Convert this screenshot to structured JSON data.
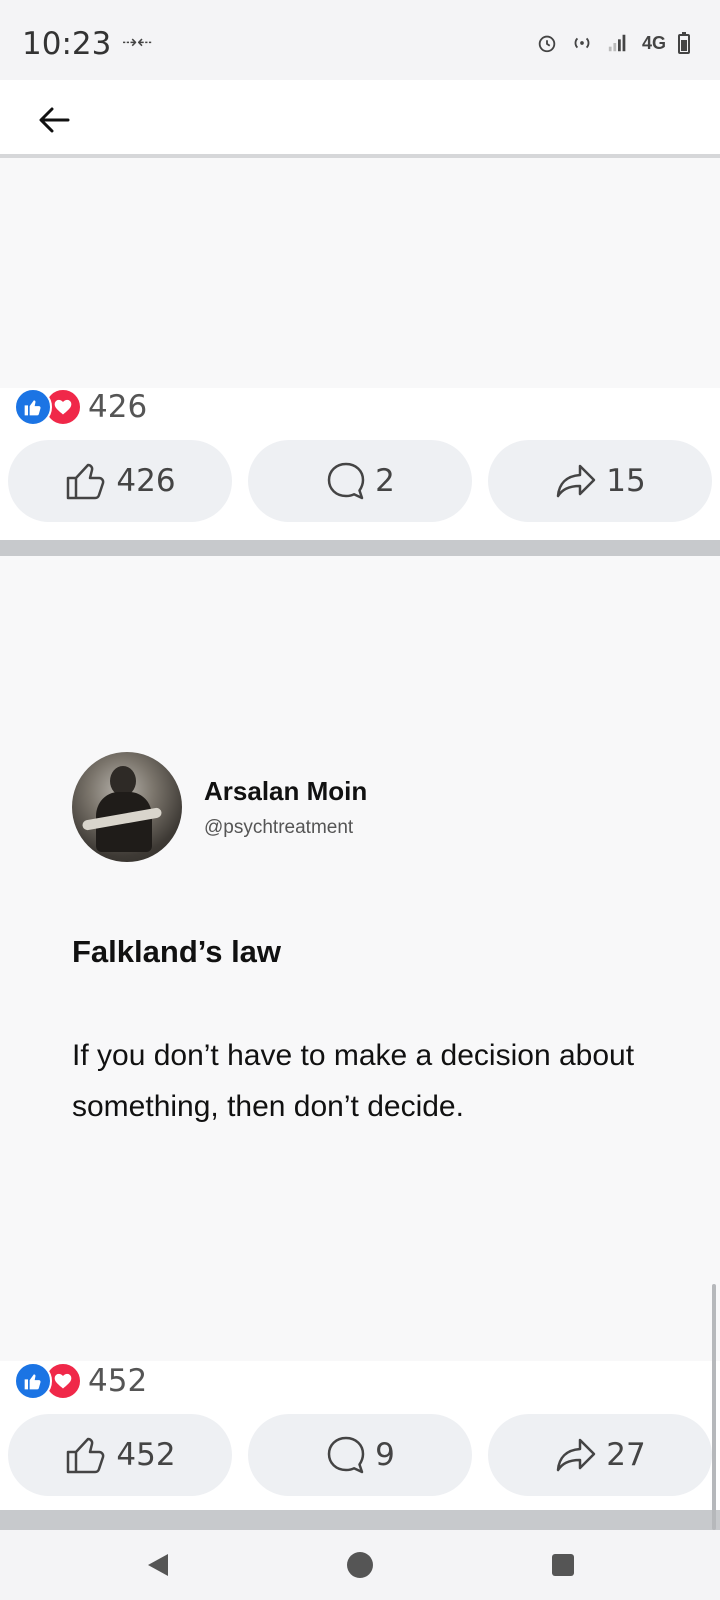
{
  "status_bar": {
    "time": "10:23",
    "network": "4G"
  },
  "posts": [
    {
      "reactions_count": "426",
      "actions": {
        "like_count": "426",
        "comment_count": "2",
        "share_count": "15"
      }
    },
    {
      "author": {
        "name": "Arsalan Moin",
        "handle": "@psychtreatment"
      },
      "title": "Falkland’s law",
      "body": "If you don’t have to make a decision about something, then don’t decide.",
      "reactions_count": "452",
      "actions": {
        "like_count": "452",
        "comment_count": "9",
        "share_count": "27"
      }
    }
  ],
  "colors": {
    "like_blue": "#1b74e4",
    "love_red": "#f02849",
    "button_bg": "#eef0f3",
    "divider": "#c7c9cc"
  }
}
